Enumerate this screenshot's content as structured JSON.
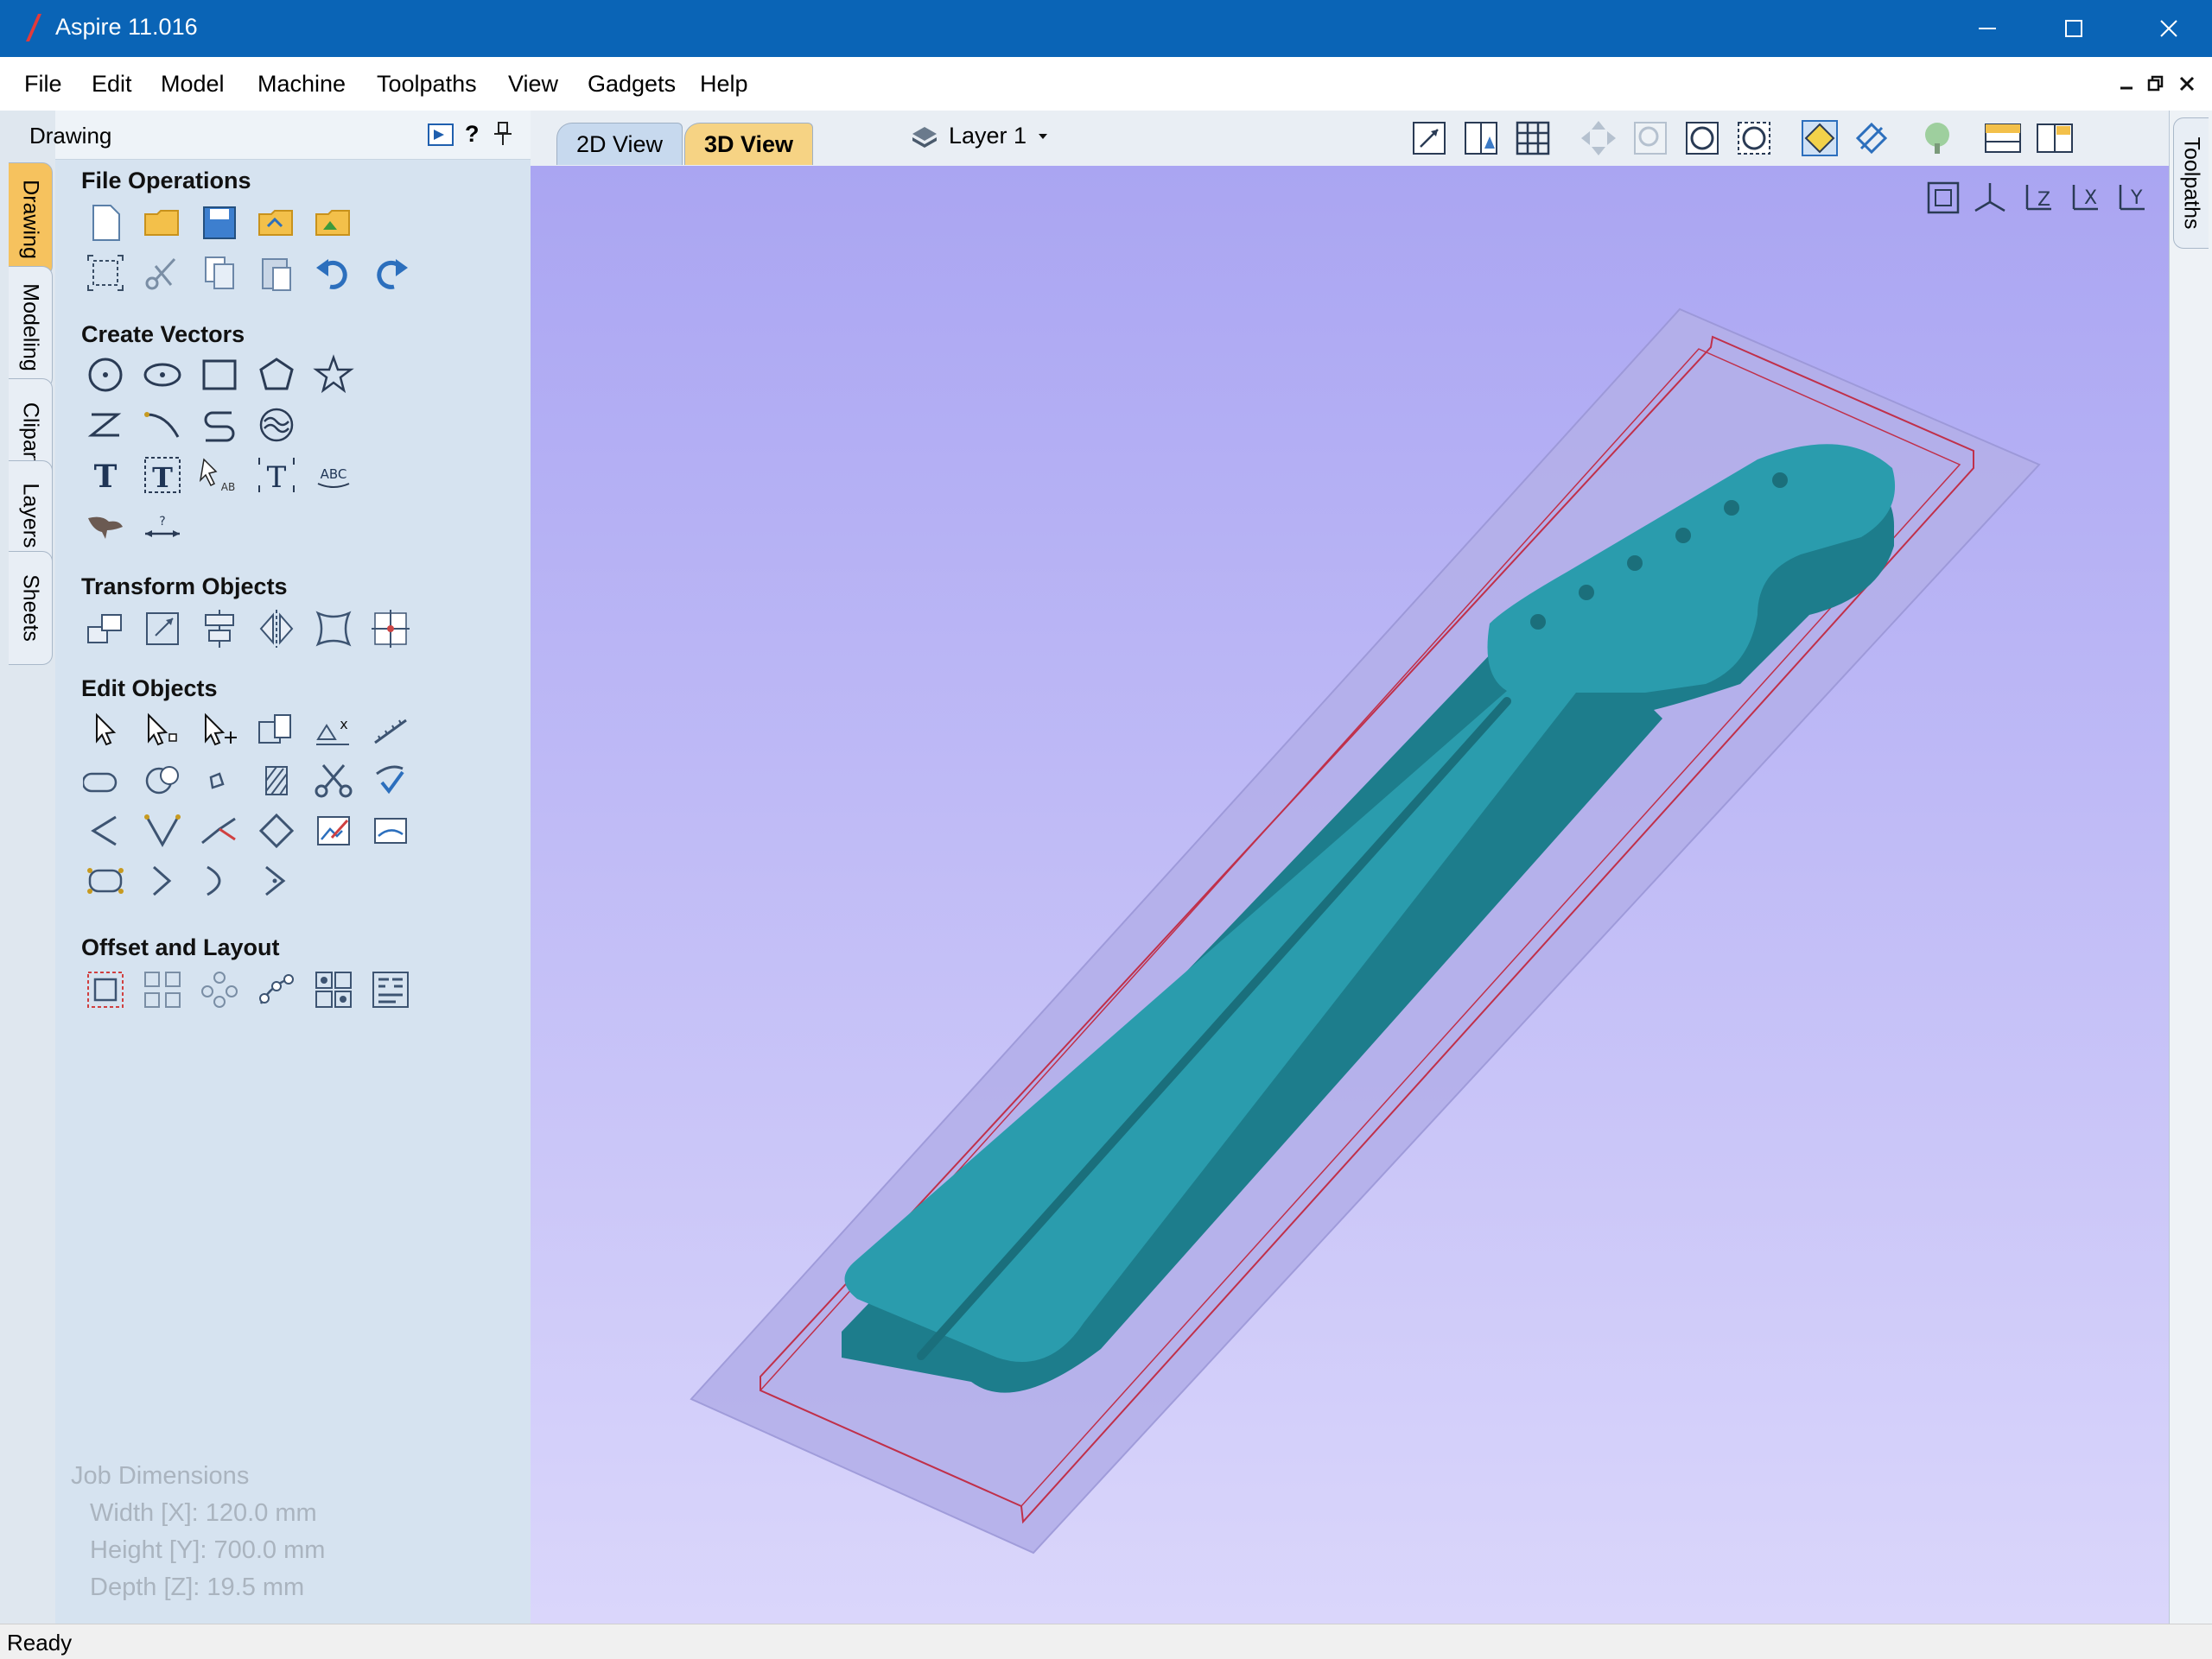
{
  "window": {
    "title": "Aspire 11.016",
    "titlebar_color": "#0a64b6"
  },
  "menu": [
    "File",
    "Edit",
    "Model",
    "Machine",
    "Toolpaths",
    "View",
    "Gadgets",
    "Help"
  ],
  "left_tabs": [
    "Drawing",
    "Modeling",
    "Clipart",
    "Layers",
    "Sheets"
  ],
  "panel": {
    "title": "Drawing",
    "sections": {
      "file_operations": "File Operations",
      "create_vectors": "Create Vectors",
      "transform_objects": "Transform Objects",
      "edit_objects": "Edit Objects",
      "offset_layout": "Offset and Layout"
    },
    "job": {
      "title": "Job Dimensions",
      "width": "Width  [X]: 120.0 mm",
      "height": "Height [Y]: 700.0 mm",
      "depth": "Depth  [Z]: 19.5 mm"
    }
  },
  "view_tabs": {
    "tab2d": "2D View",
    "tab3d": "3D View"
  },
  "layer": {
    "label": "Layer 1"
  },
  "right_tab": "Toolpaths",
  "status": "Ready",
  "colors": {
    "panel_bg": "#d6e3f0",
    "active_tab": "#f6c25e",
    "model": "#2a9cad",
    "outline": "#c0304a"
  }
}
